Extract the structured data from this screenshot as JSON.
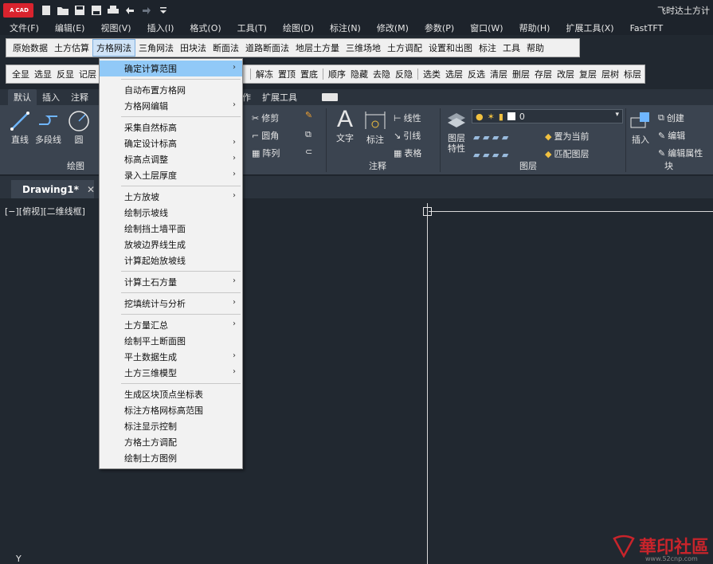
{
  "app": {
    "logo": "A",
    "logo_sub": "CAD",
    "title": "飞时达土方计"
  },
  "menubar": [
    "文件(F)",
    "编辑(E)",
    "视图(V)",
    "插入(I)",
    "格式(O)",
    "工具(T)",
    "绘图(D)",
    "标注(N)",
    "修改(M)",
    "参数(P)",
    "窗口(W)",
    "帮助(H)",
    "扩展工具(X)",
    "FastTFT"
  ],
  "toolbar1": [
    "原始数据",
    "土方估算",
    "方格网法",
    "三角网法",
    "田块法",
    "断面法",
    "道路断面法",
    "地层土方量",
    "三维场地",
    "土方调配",
    "设置和出图",
    "标注",
    "工具",
    "帮助"
  ],
  "toolbar2": {
    "left": [
      "全显",
      "选显",
      "反显",
      "记层"
    ],
    "group_a": [
      "解冻",
      "置顶",
      "置底"
    ],
    "group_b": [
      "顺序",
      "隐藏",
      "去隐",
      "反隐"
    ],
    "group_c": [
      "选类",
      "选层",
      "反选",
      "清层",
      "删层",
      "存层",
      "改层",
      "复层",
      "层树",
      "标层"
    ]
  },
  "ribbon_tabs": [
    "默认",
    "插入",
    "注释",
    "协作",
    "扩展工具"
  ],
  "ribbon": {
    "draw": {
      "line": "直线",
      "polyline": "多段线",
      "circle": "圆",
      "panel": "绘图"
    },
    "modify": {
      "trim": "修剪",
      "fillet": "圆角",
      "array": "阵列"
    },
    "annotation": {
      "text": "文字",
      "dimension": "标注",
      "linetype": "线性",
      "leader": "引线",
      "table": "表格",
      "panel": "注释"
    },
    "layers": {
      "properties": "图层特性",
      "current_layer": "0",
      "set_current": "置为当前",
      "match": "匹配图层",
      "panel": "图层"
    },
    "block": {
      "insert": "插入",
      "create": "创建",
      "edit": "编辑",
      "edit_attr": "编辑属性",
      "panel": "块"
    }
  },
  "doc_tab": {
    "name": "Drawing1*",
    "close": "✕"
  },
  "viewport_label": "[−][俯视][二维线框]",
  "ucs_label": "Y",
  "watermark": {
    "text": "華印社區",
    "url": "www.52cnp.com"
  },
  "dropdown": [
    {
      "label": "确定计算范围",
      "submenu": true,
      "highlight": true
    },
    {
      "sep": true
    },
    {
      "label": "自动布置方格网",
      "submenu": false
    },
    {
      "label": "方格网编辑",
      "submenu": true
    },
    {
      "sep": true
    },
    {
      "label": "采集自然标高",
      "submenu": false
    },
    {
      "label": "确定设计标高",
      "submenu": true
    },
    {
      "label": "标高点调整",
      "submenu": true
    },
    {
      "label": "录入土层厚度",
      "submenu": true
    },
    {
      "sep": true
    },
    {
      "label": "土方放坡",
      "submenu": true
    },
    {
      "label": "绘制示坡线",
      "submenu": false
    },
    {
      "label": "绘制挡土墙平面",
      "submenu": false
    },
    {
      "label": "放坡边界线生成",
      "submenu": false
    },
    {
      "label": "计算起始放坡线",
      "submenu": false
    },
    {
      "sep": true
    },
    {
      "label": "计算土石方量",
      "submenu": true
    },
    {
      "sep": true
    },
    {
      "label": "挖填统计与分析",
      "submenu": true
    },
    {
      "sep": true
    },
    {
      "label": "土方量汇总",
      "submenu": true
    },
    {
      "label": "绘制平土断面图",
      "submenu": false
    },
    {
      "label": "平土数据生成",
      "submenu": true
    },
    {
      "label": "土方三维模型",
      "submenu": true
    },
    {
      "sep": true
    },
    {
      "label": "生成区块顶点坐标表",
      "submenu": false
    },
    {
      "label": "标注方格网标高范围",
      "submenu": false
    },
    {
      "label": "标注显示控制",
      "submenu": false
    },
    {
      "label": "方格土方调配",
      "submenu": false
    },
    {
      "label": "绘制土方图例",
      "submenu": false
    }
  ]
}
